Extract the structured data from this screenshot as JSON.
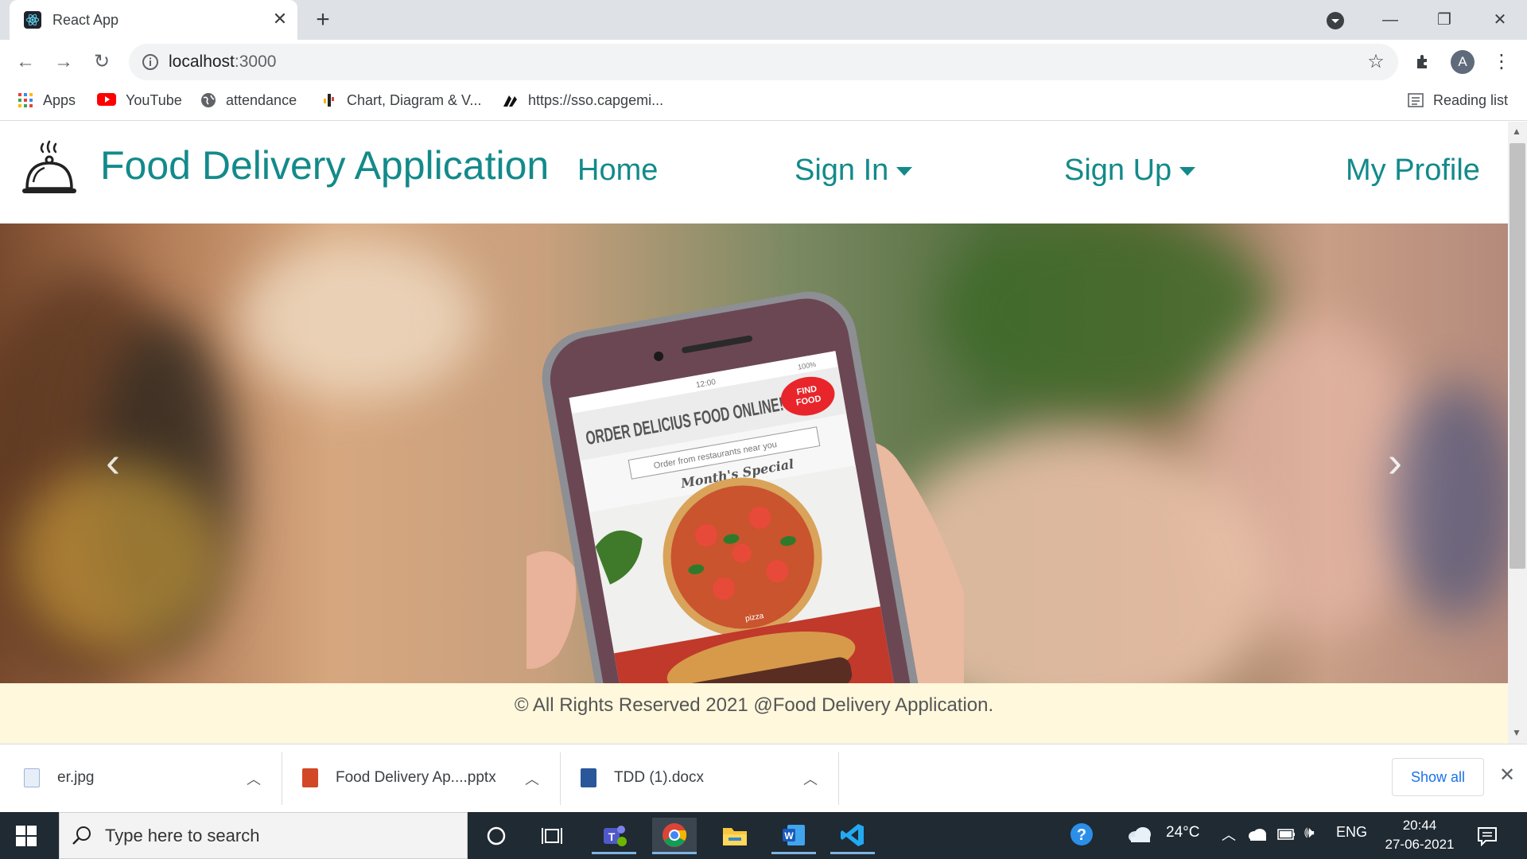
{
  "browser": {
    "tab_title": "React App",
    "url_host": "localhost",
    "url_port": ":3000",
    "profile_initial": "A"
  },
  "bookmarks": [
    {
      "label": "Apps",
      "icon": "apps-grid-icon"
    },
    {
      "label": "YouTube",
      "icon": "youtube-icon"
    },
    {
      "label": "attendance",
      "icon": "globe-icon"
    },
    {
      "label": "Chart, Diagram & V...",
      "icon": "chart-icon"
    },
    {
      "label": "https://sso.capgemi...",
      "icon": "capgemini-icon"
    }
  ],
  "reading_list": "Reading list",
  "app": {
    "brand": "Food Delivery Application",
    "nav": {
      "home": "Home",
      "sign_in": "Sign In",
      "sign_up": "Sign Up",
      "profile": "My Profile"
    },
    "carousel": {
      "headline": "ORDER DELICIUS FOOD ONLINE!",
      "badge_line1": "FIND",
      "badge_line2": "FOOD",
      "search_hint": "Order from restaurants near you",
      "special": "Month's Special",
      "pizza_label": "pizza",
      "status_time": "12:00",
      "status_battery": "100%"
    },
    "footer": "© All Rights Reserved 2021 @Food Delivery Application."
  },
  "downloads": [
    {
      "name": "er.jpg",
      "type": "image",
      "color": "#2b6cb0"
    },
    {
      "name": "Food Delivery Ap....pptx",
      "type": "pptx",
      "color": "#c43e1c"
    },
    {
      "name": "TDD (1).docx",
      "type": "docx",
      "color": "#2b579a"
    }
  ],
  "show_all": "Show all",
  "taskbar": {
    "search_placeholder": "Type here to search",
    "weather": "24°C",
    "language": "ENG",
    "time": "20:44",
    "date": "27-06-2021"
  },
  "colors": {
    "brand": "#138a8a",
    "footer_bg": "#fff8dc",
    "taskbar_bg": "#1f2a33"
  }
}
